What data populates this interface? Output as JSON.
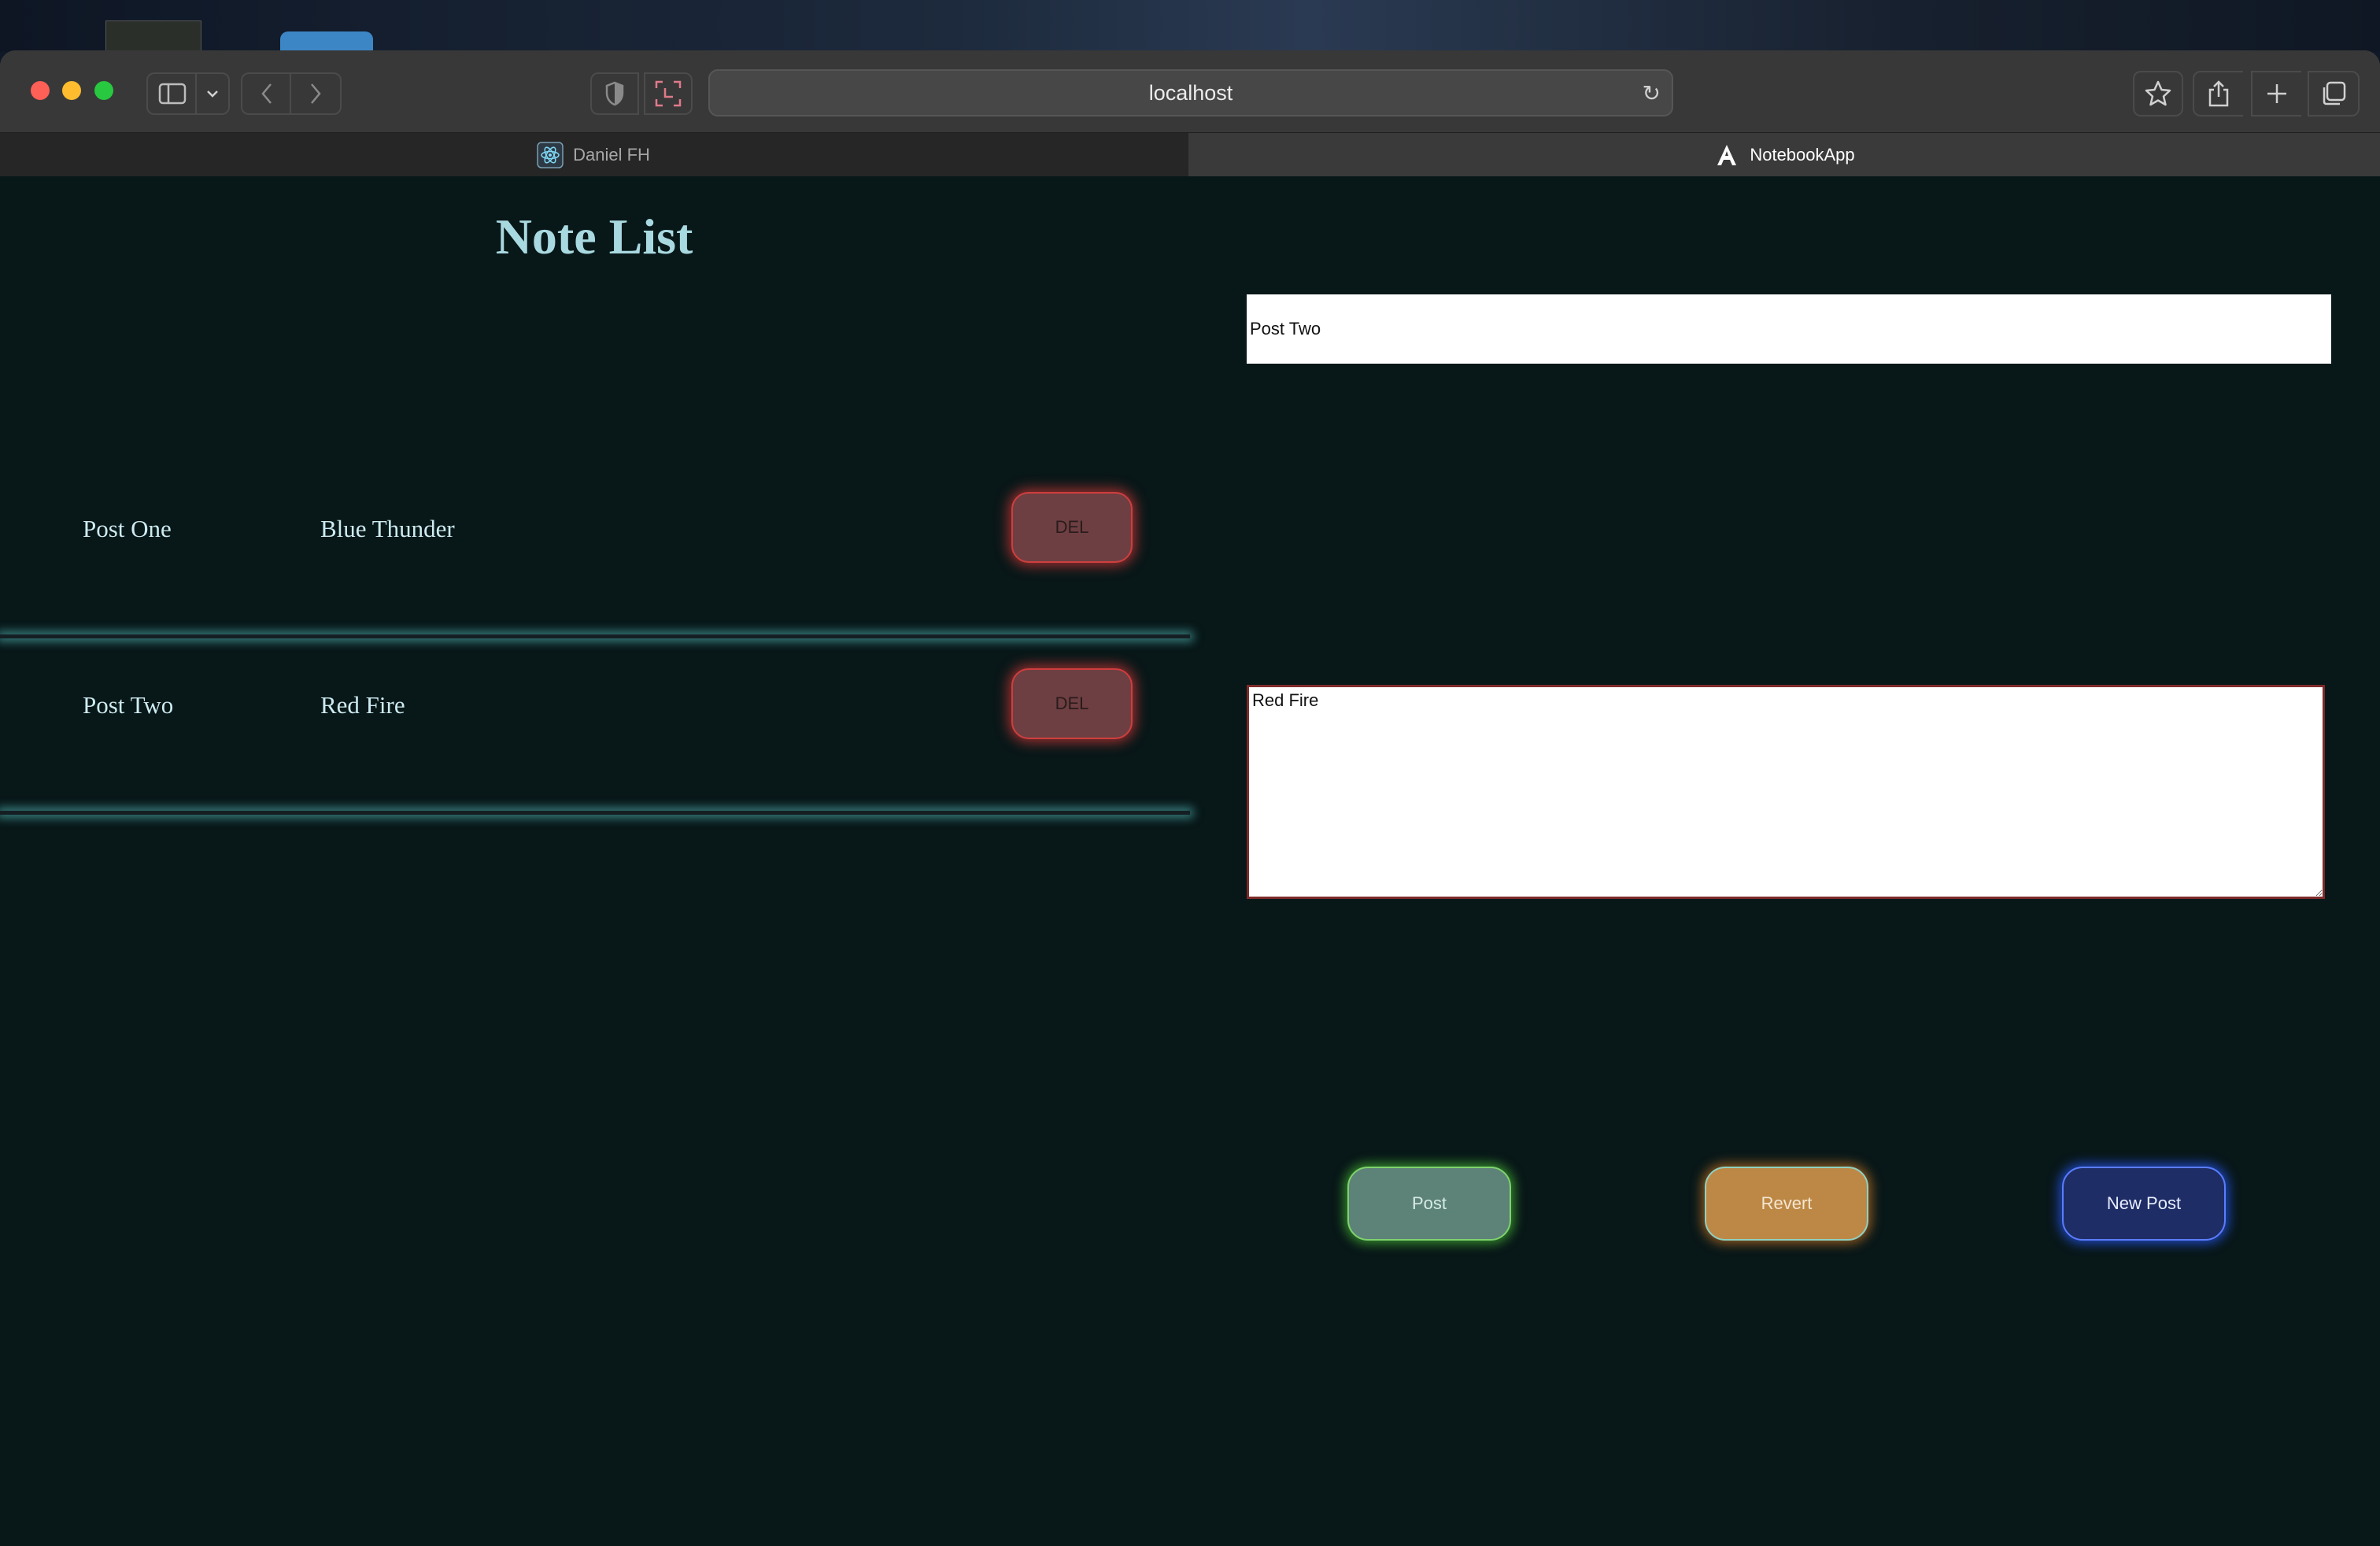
{
  "browser": {
    "address": "localhost",
    "tabs": [
      {
        "label": "Daniel FH",
        "icon": "react-icon",
        "active": false
      },
      {
        "label": "NotebookApp",
        "icon": "angular-icon",
        "active": true
      }
    ]
  },
  "notes": {
    "heading": "Note List",
    "items": [
      {
        "title": "Post One",
        "body": "Blue Thunder",
        "delete_label": "DEL"
      },
      {
        "title": "Post Two",
        "body": "Red Fire",
        "delete_label": "DEL"
      }
    ]
  },
  "editor": {
    "title_value": "Post Two",
    "body_value": "Red Fire",
    "buttons": {
      "post": "Post",
      "revert": "Revert",
      "new_post": "New Post"
    }
  },
  "colors": {
    "background": "#081718",
    "heading": "#a9d9e0",
    "delete_glow": "#eb3c3c",
    "divider_glow": "#5ac8c8",
    "post_glow": "#5ae63c",
    "revert_glow": "#f58c28",
    "new_post_glow": "#285aff"
  }
}
